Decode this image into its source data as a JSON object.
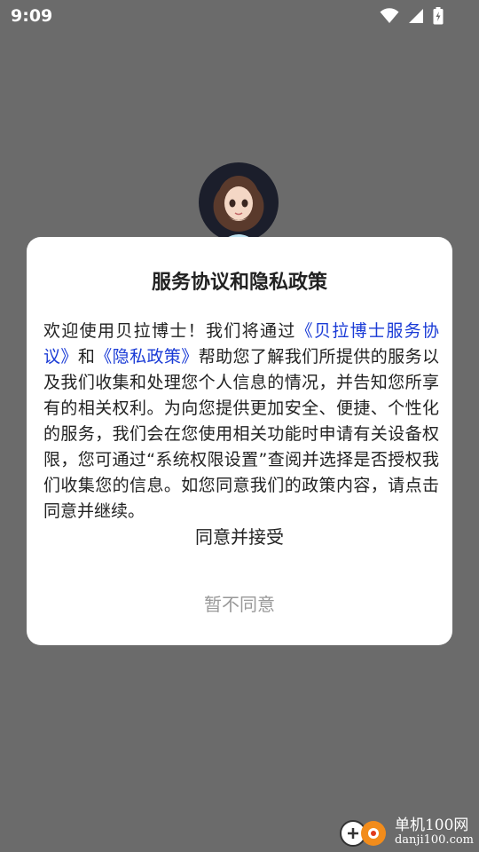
{
  "status_bar": {
    "time": "9:09"
  },
  "dialog": {
    "title": "服务协议和隐私政策",
    "body": {
      "part1": "欢迎使用贝拉博士！我们将通过",
      "link_service": "《贝拉博士服务协议》",
      "part2": "和",
      "link_privacy": "《隐私政策》",
      "part3": "帮助您了解我们所提供的服务以及我们收集和处理您个人信息的情况，并告知您所享有的相关权利。为向您提供更加安全、便捷、个性化的服务，我们会在您使用相关功能时申请有关设备权限，您可通过“系统权限设置”查阅并选择是否授权我们收集您的信息。如您同意我们的政策内容，请点击同意并继续。"
    },
    "accept_label": "同意并接受",
    "decline_label": "暂不同意"
  },
  "watermark": {
    "line1": "单机100网",
    "line2": "danji100.com"
  },
  "colors": {
    "link": "#1a3bd6",
    "overlay": "#6b6b6b",
    "decline": "#999999"
  }
}
